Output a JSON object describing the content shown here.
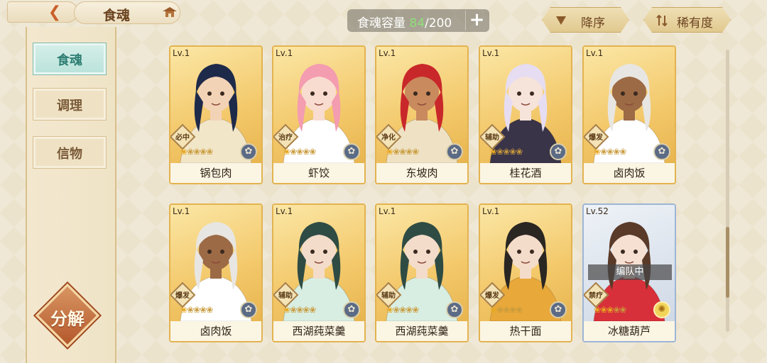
{
  "header": {
    "title": "食魂",
    "back_icon": "back-arrow-icon",
    "home_icon": "pagoda-icon"
  },
  "capacity": {
    "label": "食魂容量",
    "current": "84",
    "total": "/200",
    "plus": "+"
  },
  "sort": {
    "order_label": "降序",
    "rarity_label": "稀有度"
  },
  "sidebar": {
    "tabs": [
      {
        "label": "食魂",
        "active": true
      },
      {
        "label": "调理",
        "active": false
      },
      {
        "label": "信物",
        "active": false
      }
    ],
    "decompose_label": "分解"
  },
  "cards": [
    {
      "level": "Lv.1",
      "role": "必中",
      "name": "锅包肉",
      "stars": 1,
      "element": "moon",
      "hair": "#1e2a4a",
      "skin": "#f3d3b6",
      "cloth": "#f2e6c8"
    },
    {
      "level": "Lv.1",
      "role": "治疗",
      "name": "虾饺",
      "stars": 1,
      "element": "moon",
      "hair": "#f49cb0",
      "skin": "#f9dcd0",
      "cloth": "#ffffff"
    },
    {
      "level": "Lv.1",
      "role": "净化",
      "name": "东坡肉",
      "stars": 1,
      "element": "moon",
      "hair": "#c9282a",
      "skin": "#c98a5e",
      "cloth": "#efe2c4"
    },
    {
      "level": "Lv.1",
      "role": "辅助",
      "name": "桂花酒",
      "stars": 1,
      "element": "moon",
      "hair": "#e6ddf2",
      "skin": "#f6e3da",
      "cloth": "#3a3448"
    },
    {
      "level": "Lv.1",
      "role": "爆发",
      "name": "卤肉饭",
      "stars": 1,
      "element": "moon",
      "hair": "#e8e6e2",
      "skin": "#9c6a45",
      "cloth": "#ffffff"
    },
    {
      "level": "Lv.1",
      "role": "爆发",
      "name": "卤肉饭",
      "stars": 1,
      "element": "moon",
      "hair": "#e8e6e2",
      "skin": "#9c6a45",
      "cloth": "#ffffff"
    },
    {
      "level": "Lv.1",
      "role": "辅助",
      "name": "西湖莼菜羹",
      "stars": 1,
      "element": "moon",
      "hair": "#2f4c44",
      "skin": "#f4dccb",
      "cloth": "#d9eee2"
    },
    {
      "level": "Lv.1",
      "role": "辅助",
      "name": "西湖莼菜羹",
      "stars": 1,
      "element": "moon",
      "hair": "#2f4c44",
      "skin": "#f4dccb",
      "cloth": "#d9eee2"
    },
    {
      "level": "Lv.1",
      "role": "爆发",
      "name": "热干面",
      "stars": 1,
      "element": "moon",
      "hair": "#2a2622",
      "skin": "#f4dccb",
      "cloth": "#e8a83a"
    },
    {
      "level": "Lv.52",
      "role": "禁疗",
      "name": "冰糖葫芦",
      "stars": 3,
      "element": "sun",
      "hair": "#5a3a28",
      "skin": "#f6e0d2",
      "cloth": "#d8303a",
      "team_badge": "编队中",
      "frame": "blue"
    }
  ]
}
